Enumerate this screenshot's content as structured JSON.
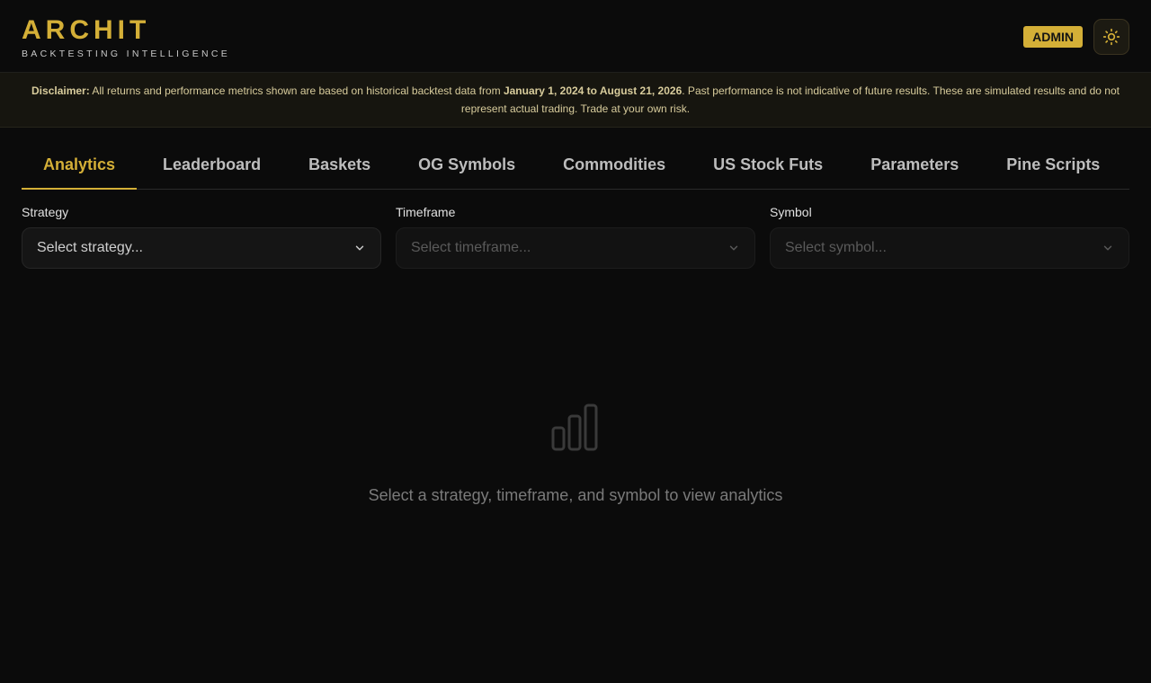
{
  "brand": {
    "title": "ARCHIT",
    "subtitle": "BACKTESTING INTELLIGENCE"
  },
  "header": {
    "admin_badge": "ADMIN",
    "theme_icon": "sun-icon"
  },
  "disclaimer": {
    "label": "Disclaimer:",
    "text1": " All returns and performance metrics shown are based on historical backtest data from ",
    "range": "January 1, 2024 to August 21, 2026",
    "text2": ". Past performance is not indicative of future results. These are simulated results and do not represent actual trading. Trade at your own risk."
  },
  "tabs": [
    {
      "label": "Analytics",
      "active": true
    },
    {
      "label": "Leaderboard"
    },
    {
      "label": "Baskets"
    },
    {
      "label": "OG Symbols"
    },
    {
      "label": "Commodities"
    },
    {
      "label": "US Stock Futs"
    },
    {
      "label": "Parameters"
    },
    {
      "label": "Pine Scripts"
    }
  ],
  "filters": {
    "strategy": {
      "label": "Strategy",
      "placeholder": "Select strategy..."
    },
    "timeframe": {
      "label": "Timeframe",
      "placeholder": "Select timeframe..."
    },
    "symbol": {
      "label": "Symbol",
      "placeholder": "Select symbol..."
    }
  },
  "empty_state": {
    "icon": "bar-chart-icon",
    "message": "Select a strategy, timeframe, and symbol to view analytics"
  },
  "colors": {
    "accent": "#d4af37",
    "background": "#0b0b0b"
  }
}
